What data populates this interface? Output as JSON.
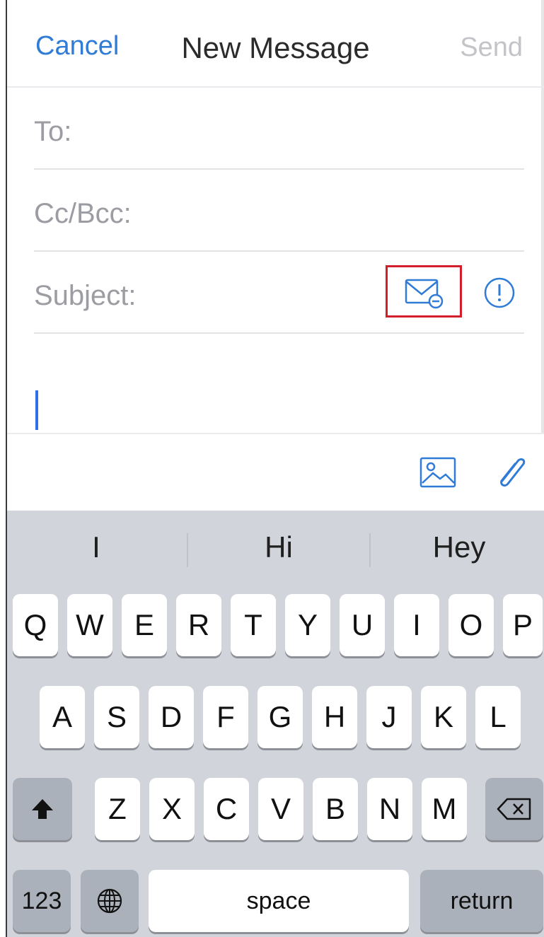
{
  "nav": {
    "cancel": "Cancel",
    "title": "New Message",
    "send": "Send"
  },
  "fields": {
    "to": "To:",
    "cc_bcc": "Cc/Bcc:",
    "subject": "Subject:"
  },
  "icons": {
    "sensitivity": "envelope-minus-icon",
    "info": "info-circle-icon",
    "image": "image-icon",
    "attach": "paperclip-icon",
    "shift": "shift-arrow-icon",
    "delete": "backspace-icon",
    "globe": "globe-icon"
  },
  "colors": {
    "accent": "#2f7bd6",
    "highlight": "#d21e2a",
    "keyboard_bg": "#d1d4db"
  },
  "keyboard": {
    "suggestions": [
      "I",
      "Hi",
      "Hey"
    ],
    "row1": [
      "Q",
      "W",
      "E",
      "R",
      "T",
      "Y",
      "U",
      "I",
      "O",
      "P"
    ],
    "row2": [
      "A",
      "S",
      "D",
      "F",
      "G",
      "H",
      "J",
      "K",
      "L"
    ],
    "row3": [
      "Z",
      "X",
      "C",
      "V",
      "B",
      "N",
      "M"
    ],
    "numbers": "123",
    "space": "space",
    "return": "return"
  }
}
